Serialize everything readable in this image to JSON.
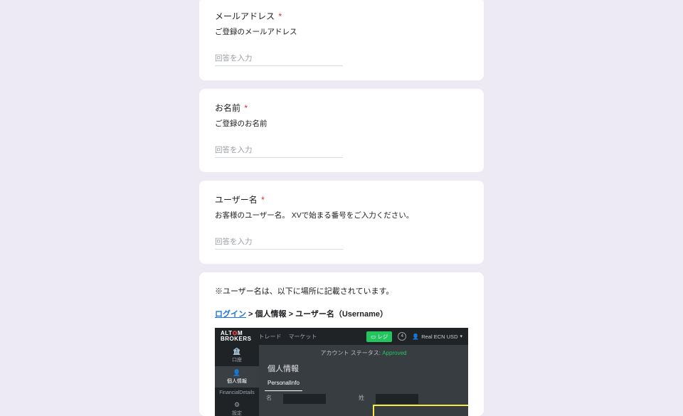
{
  "cards": {
    "email": {
      "title": "メールアドレス",
      "desc": "ご登録のメールアドレス",
      "placeholder": "回答を入力"
    },
    "name": {
      "title": "お名前",
      "desc": "ご登録のお名前",
      "placeholder": "回答を入力"
    },
    "username": {
      "title": "ユーザー名",
      "desc": "お客様のユーザー名。 XVで始まる番号をご入力ください。",
      "placeholder": "回答を入力"
    }
  },
  "info": {
    "note": "※ユーザー名は、以下に場所に記載されています。",
    "bc_login": "ログイン",
    "bc_rest": " > 個人情報 > ユーザー名（Username）"
  },
  "embed": {
    "logo_top": "ALT",
    "logo_accent": "⏣",
    "logo_top2": "M",
    "logo_bottom": "BROKERS",
    "nav1": "トレード",
    "nav2": "マーケット",
    "green_btn": "レジ",
    "badge": "4",
    "account": "Real ECN USD",
    "sb": {
      "i1": "口座",
      "i2": "個人情報",
      "i3": "FinancialDetails",
      "i4": "設定"
    },
    "status_label": "アカウント ステータス:",
    "status_value": "Approved",
    "page_heading": "個人情報",
    "tab1": "PersonalInfo",
    "fld1": "名",
    "fld2": "姓"
  },
  "req_mark": "*"
}
